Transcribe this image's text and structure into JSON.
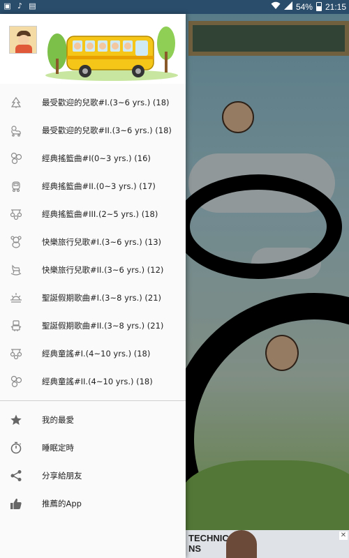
{
  "status_bar": {
    "left_icons": [
      "image-icon",
      "music-icon",
      "sim-icon"
    ],
    "battery": "54%",
    "time": "21:15"
  },
  "drawer": {
    "playlists": [
      {
        "label": "最受歡迎的兒歌#I.(3~6 yrs.)   (18)",
        "icon": "christmas-tree-icon"
      },
      {
        "label": "最受歡迎的兒歌#II.(3~6 yrs.)   (18)",
        "icon": "duck-toy-icon"
      },
      {
        "label": "經典搖籃曲#I(0~3 yrs.)   (16)",
        "icon": "pinwheel-icon"
      },
      {
        "label": "經典搖籃曲#II.(0~3 yrs.)   (17)",
        "icon": "toy-car-icon"
      },
      {
        "label": "經典搖籃曲#III.(2~5 yrs.)   (18)",
        "icon": "baby-mobile-icon"
      },
      {
        "label": "快樂旅行兒歌#I.(3~6 yrs.)   (13)",
        "icon": "teddy-bear-icon"
      },
      {
        "label": "快樂旅行兒歌#II.(3~6 yrs.)   (12)",
        "icon": "rocking-horse-icon"
      },
      {
        "label": "聖誕假期歌曲#I.(3~8 yrs.)   (21)",
        "icon": "sunrise-icon"
      },
      {
        "label": "聖誕假期歌曲#II.(3~8 yrs.)   (21)",
        "icon": "robot-icon"
      },
      {
        "label": "經典童謠#I.(4~10 yrs.)   (18)",
        "icon": "baby-mobile-icon"
      },
      {
        "label": "經典童謠#II.(4~10 yrs.)   (18)",
        "icon": "pinwheel-icon"
      }
    ],
    "actions": [
      {
        "label": "我的最愛",
        "icon": "star-icon"
      },
      {
        "label": "睡眠定時",
        "icon": "timer-icon"
      },
      {
        "label": "分享給朋友",
        "icon": "share-icon"
      },
      {
        "label": "推薦的App",
        "icon": "thumbs-up-icon"
      }
    ]
  },
  "ad": {
    "text_line1": "TECHNICAL",
    "text_line2": "NS"
  },
  "colors": {
    "status_bar": "#2a4d6b",
    "drawer_bg": "#fafafa",
    "icon_gray": "#8a8a8a",
    "bus_yellow": "#f5c518"
  }
}
